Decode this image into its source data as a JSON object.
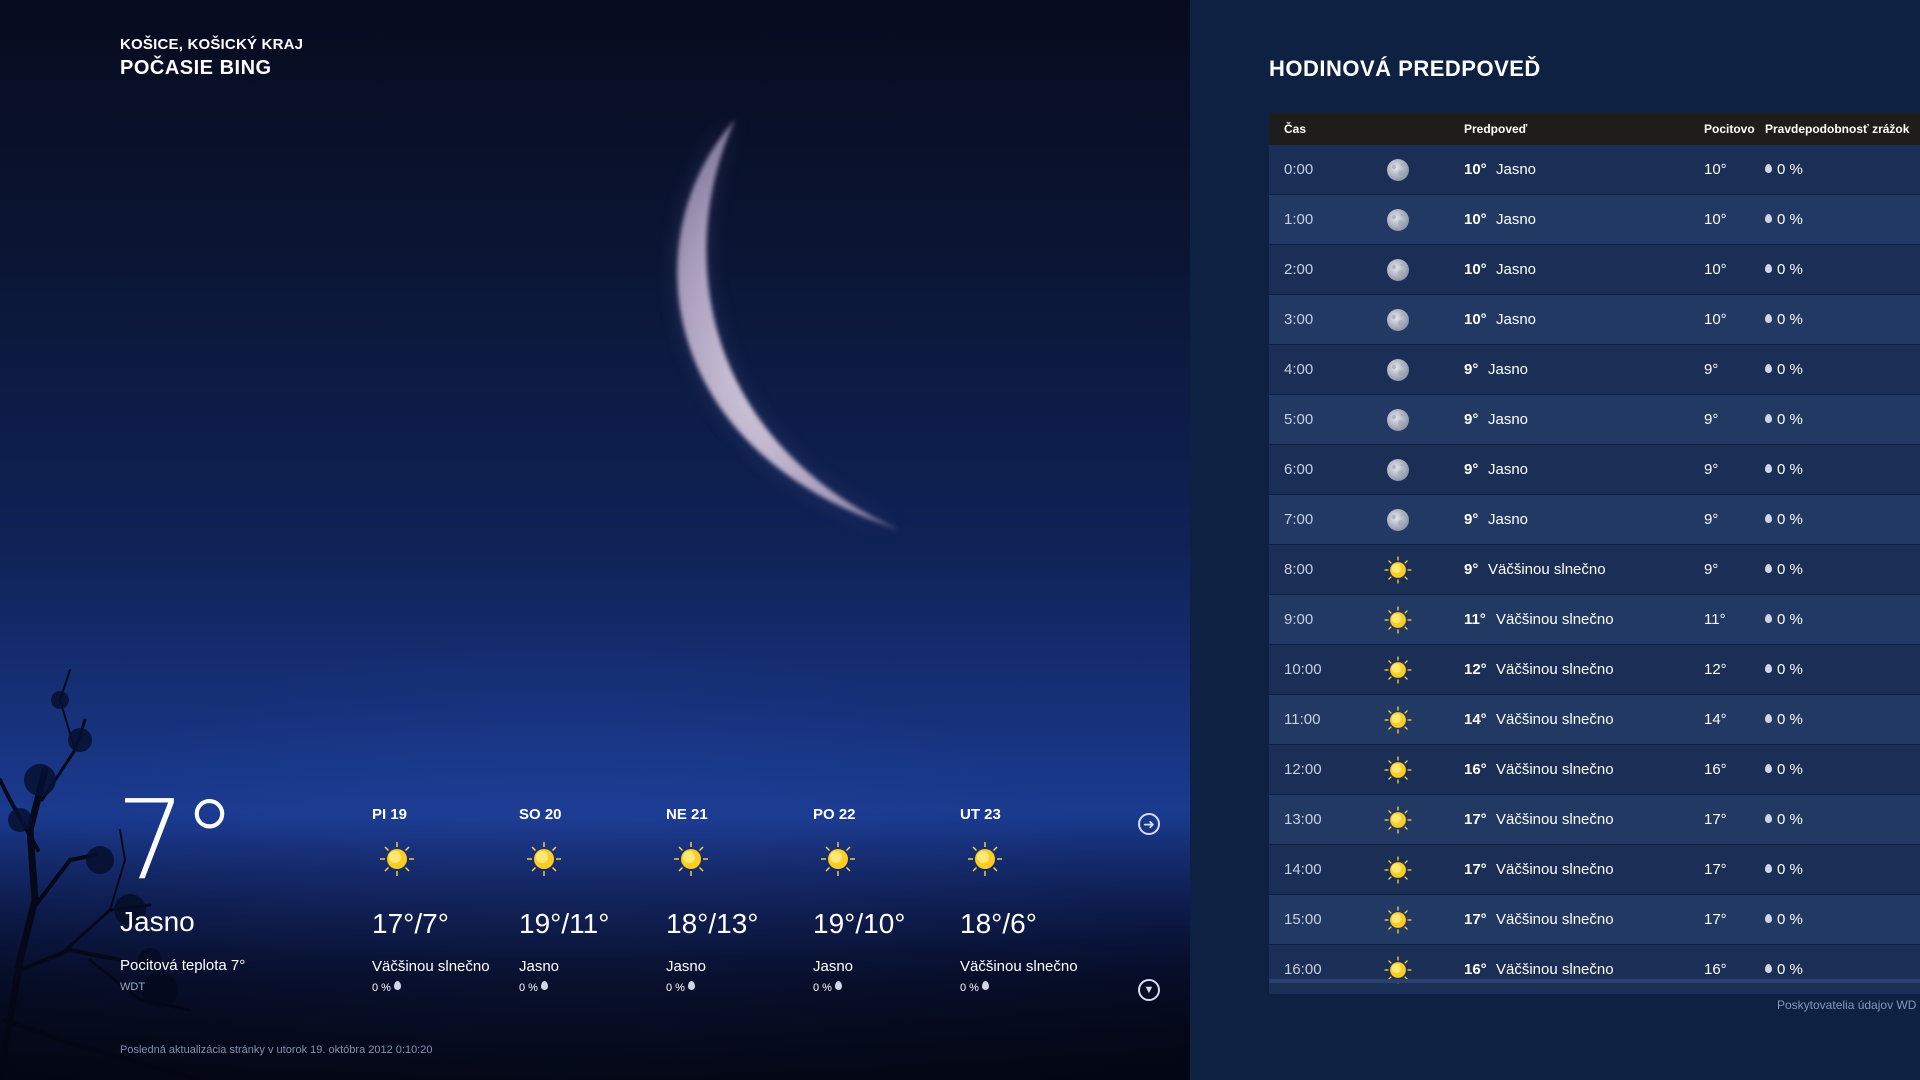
{
  "location": {
    "city": "KOŠICE, KOŠICKÝ KRAJ",
    "brand": "POČASIE BING"
  },
  "current": {
    "temp": "7°",
    "condition": "Jasno",
    "feels": "Pocitová teplota 7°",
    "source": "WDT"
  },
  "daily": [
    {
      "day": "PI 19",
      "range": "17°/7°",
      "condition": "Väčšinou slnečno",
      "precip": "0 %",
      "icon": "sun-icon"
    },
    {
      "day": "SO 20",
      "range": "19°/11°",
      "condition": "Jasno",
      "precip": "0 %",
      "icon": "sun-icon"
    },
    {
      "day": "NE 21",
      "range": "18°/13°",
      "condition": "Jasno",
      "precip": "0 %",
      "icon": "sun-icon"
    },
    {
      "day": "PO 22",
      "range": "19°/10°",
      "condition": "Jasno",
      "precip": "0 %",
      "icon": "sun-icon"
    },
    {
      "day": "UT 23",
      "range": "18°/6°",
      "condition": "Väčšinou slnečno",
      "precip": "0 %",
      "icon": "sun-icon"
    }
  ],
  "nav": {
    "next_icon": "arrow-right-circle-icon",
    "down_icon": "arrow-down-circle-icon"
  },
  "last_update": "Posledná aktualizácia stránky v utorok 19. októbra 2012 0:10:20",
  "hourly": {
    "title": "HODINOVÁ PREDPOVEĎ",
    "headers": {
      "time": "Čas",
      "forecast": "Predpoveď",
      "feels": "Pocitovo",
      "precip": "Pravdepodobnosť zrážok"
    },
    "rows": [
      {
        "time": "0:00",
        "icon": "moon-icon",
        "temp": "10°",
        "cond": "Jasno",
        "feels": "10°",
        "precip": "0 %"
      },
      {
        "time": "1:00",
        "icon": "moon-icon",
        "temp": "10°",
        "cond": "Jasno",
        "feels": "10°",
        "precip": "0 %"
      },
      {
        "time": "2:00",
        "icon": "moon-icon",
        "temp": "10°",
        "cond": "Jasno",
        "feels": "10°",
        "precip": "0 %"
      },
      {
        "time": "3:00",
        "icon": "moon-icon",
        "temp": "10°",
        "cond": "Jasno",
        "feels": "10°",
        "precip": "0 %"
      },
      {
        "time": "4:00",
        "icon": "moon-icon",
        "temp": "9°",
        "cond": "Jasno",
        "feels": "9°",
        "precip": "0 %"
      },
      {
        "time": "5:00",
        "icon": "moon-icon",
        "temp": "9°",
        "cond": "Jasno",
        "feels": "9°",
        "precip": "0 %"
      },
      {
        "time": "6:00",
        "icon": "moon-icon",
        "temp": "9°",
        "cond": "Jasno",
        "feels": "9°",
        "precip": "0 %"
      },
      {
        "time": "7:00",
        "icon": "moon-icon",
        "temp": "9°",
        "cond": "Jasno",
        "feels": "9°",
        "precip": "0 %"
      },
      {
        "time": "8:00",
        "icon": "sun-icon",
        "temp": "9°",
        "cond": "Väčšinou slnečno",
        "feels": "9°",
        "precip": "0 %"
      },
      {
        "time": "9:00",
        "icon": "sun-icon",
        "temp": "11°",
        "cond": "Väčšinou slnečno",
        "feels": "11°",
        "precip": "0 %"
      },
      {
        "time": "10:00",
        "icon": "sun-icon",
        "temp": "12°",
        "cond": "Väčšinou slnečno",
        "feels": "12°",
        "precip": "0 %"
      },
      {
        "time": "11:00",
        "icon": "sun-icon",
        "temp": "14°",
        "cond": "Väčšinou slnečno",
        "feels": "14°",
        "precip": "0 %"
      },
      {
        "time": "12:00",
        "icon": "sun-icon",
        "temp": "16°",
        "cond": "Väčšinou slnečno",
        "feels": "16°",
        "precip": "0 %"
      },
      {
        "time": "13:00",
        "icon": "sun-icon",
        "temp": "17°",
        "cond": "Väčšinou slnečno",
        "feels": "17°",
        "precip": "0 %"
      },
      {
        "time": "14:00",
        "icon": "sun-icon",
        "temp": "17°",
        "cond": "Väčšinou slnečno",
        "feels": "17°",
        "precip": "0 %"
      },
      {
        "time": "15:00",
        "icon": "sun-icon",
        "temp": "17°",
        "cond": "Väčšinou slnečno",
        "feels": "17°",
        "precip": "0 %"
      },
      {
        "time": "16:00",
        "icon": "sun-icon",
        "temp": "16°",
        "cond": "Väčšinou slnečno",
        "feels": "16°",
        "precip": "0 %"
      }
    ],
    "providers": "Poskytovatelia údajov WD"
  }
}
